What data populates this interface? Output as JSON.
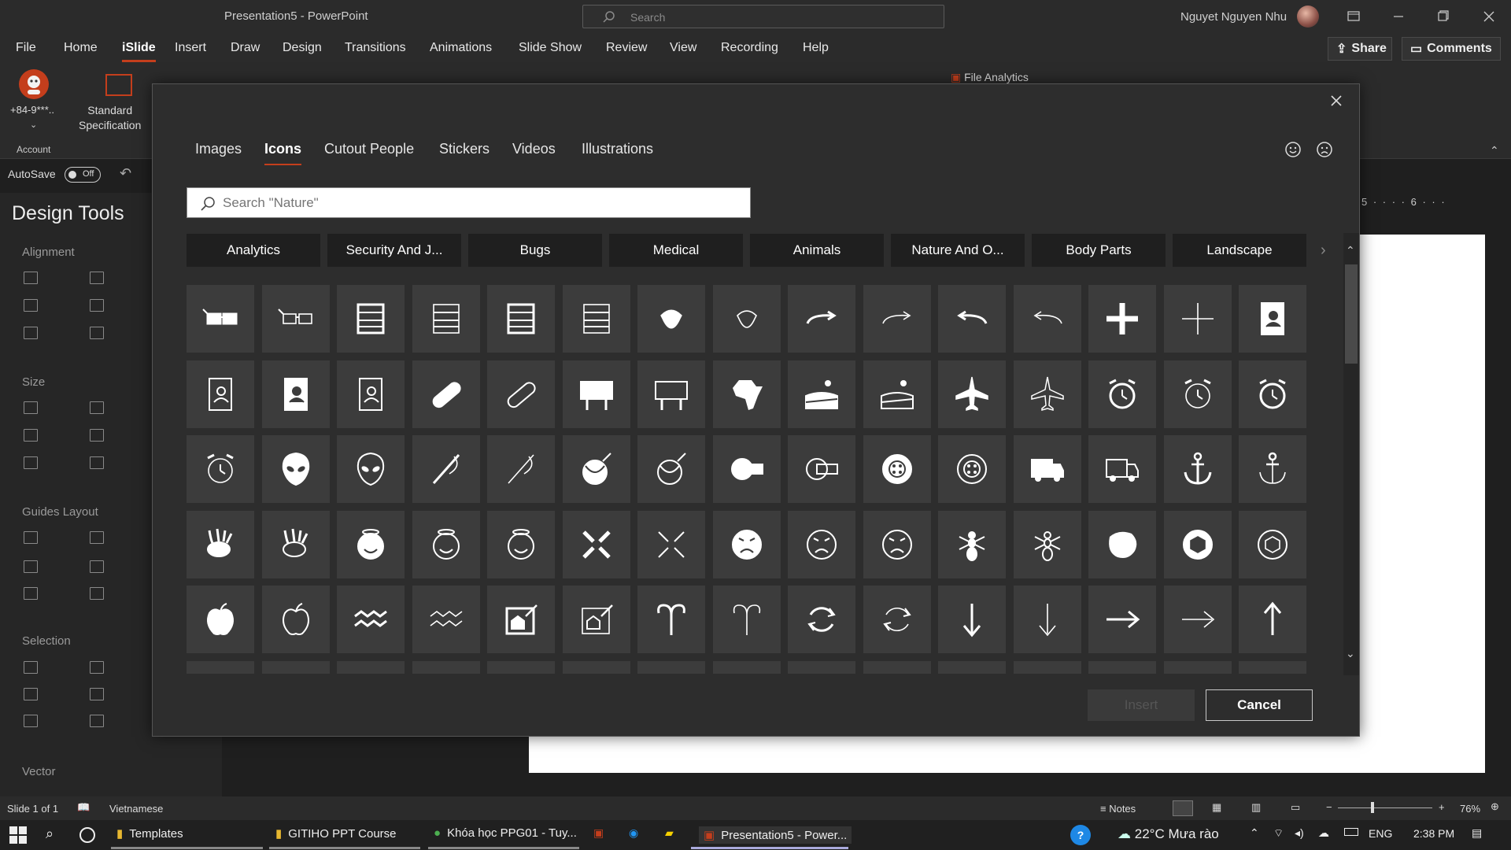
{
  "titlebar": {
    "document_title": "Presentation5  -  PowerPoint",
    "search_placeholder": "Search",
    "user_name": "Nguyet Nguyen Nhu"
  },
  "menu": [
    "File",
    "Home",
    "iSlide",
    "Insert",
    "Draw",
    "Design",
    "Transitions",
    "Animations",
    "Slide Show",
    "Review",
    "View",
    "Recording",
    "Help"
  ],
  "menu_active": "iSlide",
  "top_buttons": {
    "share": "Share",
    "comments": "Comments"
  },
  "ribbon": {
    "account_phone": "+84-9***..",
    "account_label": "Account",
    "standard_spec_line1": "Standard",
    "standard_spec_line2": "Specification",
    "file_analytics": "File Analytics"
  },
  "autosave": {
    "label": "AutoSave",
    "state": "Off"
  },
  "left_pane": {
    "title": "Design Tools",
    "sections": [
      "Alignment",
      "Size",
      "Guides Layout",
      "Selection",
      "Vector"
    ]
  },
  "ruler": {
    "labels": "5 · · · · 6 · · ·"
  },
  "statusbar": {
    "slide": "Slide 1 of 1",
    "language": "Vietnamese",
    "notes": "Notes",
    "zoom": "76%"
  },
  "taskbar": {
    "items": [
      "Templates",
      "GITIHO PPT Course",
      "Khóa học PPG01 - Tuy...",
      "Presentation5 - Power..."
    ],
    "weather": "22°C  Mưa rào",
    "lang": "ENG",
    "time": "2:38 PM"
  },
  "dialog": {
    "tabs": [
      "Images",
      "Icons",
      "Cutout People",
      "Stickers",
      "Videos",
      "Illustrations"
    ],
    "active_tab": "Icons",
    "search_placeholder": "Search \"Nature\"",
    "categories": [
      "Analytics",
      "Security And J...",
      "Bugs",
      "Medical",
      "Animals",
      "Nature And O...",
      "Body Parts",
      "Landscape"
    ],
    "insert_label": "Insert",
    "cancel_label": "Cancel",
    "icons": [
      "3d-glasses-filled",
      "3d-glasses-outline",
      "abacus-filled",
      "abacus-outline",
      "abacus-wide-filled",
      "abacus-wide-outline",
      "acorn-filled",
      "acorn-outline",
      "arrow-curve-right-filled",
      "arrow-curve-right-outline",
      "arrow-curve-left-filled",
      "arrow-curve-left-outline",
      "plus-filled",
      "plus-outline",
      "address-book-filled",
      "address-book-outline",
      "contact-card-filled",
      "contact-card-outline",
      "bandage-filled",
      "bandage-outline",
      "billboard-filled",
      "billboard-outline",
      "africa-filled",
      "farm-landscape-filled",
      "farm-landscape-outline",
      "airplane-filled",
      "airplane-outline",
      "alarm-clock-filled",
      "alarm-clock-outline",
      "alarm-ringing-filled",
      "alarm-ringing-outline",
      "alien-face-filled",
      "alien-face-outline",
      "sewing-needle-filled",
      "sewing-needle-outline",
      "yarn-ball-filled",
      "yarn-ball-outline",
      "tape-measure-filled",
      "tape-measure-outline",
      "button-filled",
      "button-outline",
      "ambulance-filled",
      "ambulance-outline",
      "anchor-filled",
      "anchor-outline",
      "anemone-fish-filled",
      "anemone-fish-outline",
      "angel-face-filled",
      "angel-face-outline",
      "angel-face-line",
      "anger-symbol-filled",
      "anger-symbol-outline",
      "angry-face-filled",
      "angry-face-outline",
      "angry-face-line",
      "ant-filled",
      "ant-outline",
      "antarctica-filled",
      "aperture-filled",
      "aperture-outline",
      "apple-filled",
      "apple-outline",
      "aquarius-filled",
      "aquarius-outline",
      "architect-drawing-filled",
      "architect-drawing-outline",
      "aries-filled",
      "aries-outline",
      "refresh-filled",
      "refresh-outline",
      "arrow-down-filled",
      "arrow-down-outline",
      "arrow-right-filled",
      "arrow-right-outline",
      "arrow-up-filled"
    ]
  }
}
